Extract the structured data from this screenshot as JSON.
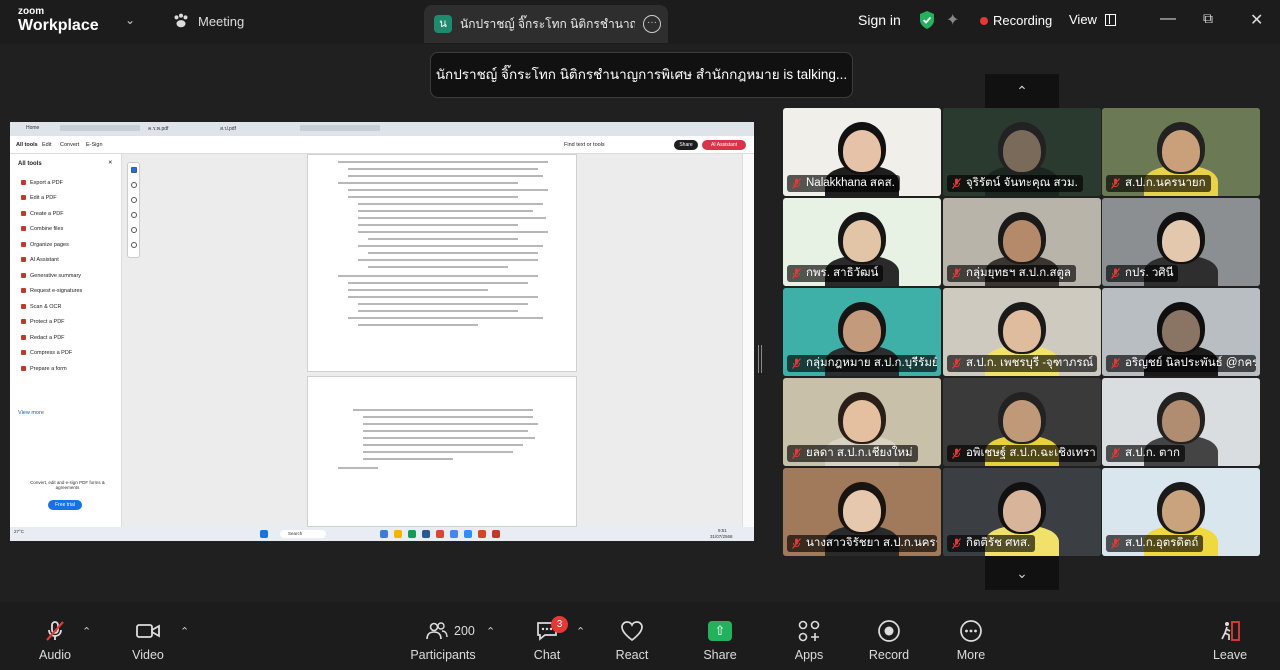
{
  "app": {
    "brand_top": "zoom",
    "brand_bottom": "Workplace"
  },
  "header": {
    "meeting_label": "Meeting",
    "active_speaker_initial": "น",
    "active_speaker_name": "นักปราชญ์ จิ๊กระโทก นิติกรชำนาญการ",
    "sign_in": "Sign in",
    "recording": "Recording",
    "view": "View"
  },
  "talking_banner": "นักปราชญ์ จิ๊กระโทก นิติกรชำนาญการพิเศษ สำนักกฎหมาย is talking...",
  "gallery": {
    "participants": [
      {
        "name": "Nalakkhana สคส."
      },
      {
        "name": "จุริรัตน์ จันทะคุณ สวม."
      },
      {
        "name": "ส.ป.ก.นครนายก"
      },
      {
        "name": "กพร. สาธิวัฒน์"
      },
      {
        "name": "กลุ่มยุทธฯ ส.ป.ก.สตูล"
      },
      {
        "name": "กปร. วศินี"
      },
      {
        "name": "กลุ่มกฎหมาย ส.ป.ก.บุรีรัมย์"
      },
      {
        "name": "ส.ป.ก. เพชรบุรี -จุฑาภรณ์"
      },
      {
        "name": "อริญชย์ นิลประพันธ์ @กคร."
      },
      {
        "name": "ยลดา ส.ป.ก.เชียงใหม่"
      },
      {
        "name": "อพิเชษฐ์ ส.ป.ก.ฉะเชิงเทรา"
      },
      {
        "name": "ส.ป.ก. ตาก"
      },
      {
        "name": "นางสาวจิรัชยา ส.ป.ก.นครร..."
      },
      {
        "name": "กิตติรัช ศทส."
      },
      {
        "name": "ส.ป.ก.อุตรดิตถ์"
      }
    ]
  },
  "shared_screen": {
    "tabs": [
      "Home",
      "ค.ร.พ.pdf",
      "ส.ป.pdf"
    ],
    "menu": [
      "All tools",
      "Edit",
      "Convert",
      "E-Sign"
    ],
    "find_placeholder": "Find text or tools",
    "share": "Share",
    "ai_assistant": "AI Assistant",
    "tools_title": "All tools",
    "tools": [
      "Export a PDF",
      "Edit a PDF",
      "Create a PDF",
      "Combine files",
      "Organize pages",
      "AI Assistant",
      "Generative summary",
      "Request e-signatures",
      "Scan & OCR",
      "Protect a PDF",
      "Redact a PDF",
      "Compress a PDF",
      "Prepare a form"
    ],
    "view_more": "View more",
    "convert_note": "Convert, edit and e-sign PDF forms & agreements",
    "free_trial": "Free trial",
    "taskbar_search": "Search",
    "weather": "27°C",
    "clock_time": "9:51",
    "clock_date": "31/07/2568"
  },
  "toolbar": {
    "audio": "Audio",
    "video": "Video",
    "participants": "Participants",
    "participant_count": "200",
    "chat": "Chat",
    "chat_badge": "3",
    "react": "React",
    "share": "Share",
    "apps": "Apps",
    "record": "Record",
    "more": "More",
    "leave": "Leave"
  }
}
